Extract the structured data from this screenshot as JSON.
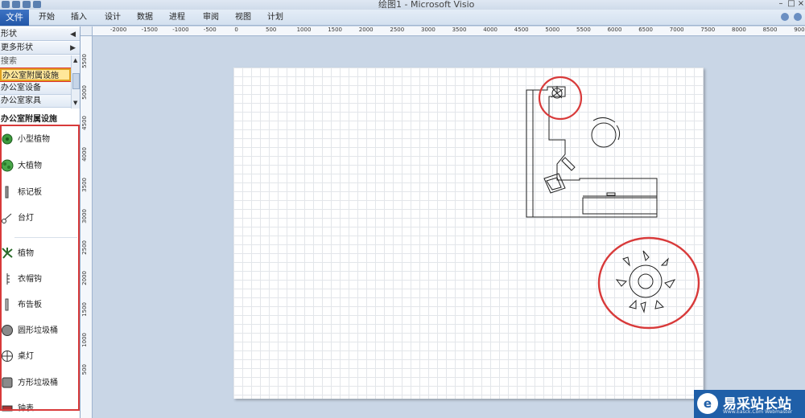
{
  "window": {
    "title": "绘图1 - Microsoft Visio"
  },
  "ribbon": {
    "file_label": "文件",
    "tabs": [
      "开始",
      "插入",
      "设计",
      "数据",
      "进程",
      "审阅",
      "视图",
      "计划"
    ]
  },
  "shapes_panel": {
    "header": "形状",
    "more_shapes": "更多形状",
    "search": "搜索",
    "stencils": [
      "办公室附属设施",
      "办公室设备",
      "办公室家具"
    ],
    "section_title": "办公室附属设施",
    "items": [
      {
        "label": "小型植物",
        "icon": "small-plant-icon"
      },
      {
        "label": "大植物",
        "icon": "large-plant-icon"
      },
      {
        "label": "标记板",
        "icon": "marker-board-icon"
      },
      {
        "label": "台灯",
        "icon": "desk-lamp-icon"
      },
      {
        "label": "植物",
        "icon": "plant-icon"
      },
      {
        "label": "衣帽钩",
        "icon": "coat-hook-icon"
      },
      {
        "label": "布告板",
        "icon": "bulletin-board-icon"
      },
      {
        "label": "圆形垃圾桶",
        "icon": "round-wastebasket-icon"
      },
      {
        "label": "桌灯",
        "icon": "table-lamp-icon"
      },
      {
        "label": "方形垃圾桶",
        "icon": "square-wastebasket-icon"
      },
      {
        "label": "钟表",
        "icon": "clock-icon"
      }
    ]
  },
  "ruler": {
    "top_labels": [
      "-2000",
      "-1500",
      "-1000",
      "-500",
      "0",
      "500",
      "1000",
      "1500",
      "2000",
      "2500",
      "3000",
      "3500",
      "4000",
      "4500",
      "5000",
      "5500",
      "6000",
      "6500",
      "7000",
      "7500",
      "8000",
      "8500",
      "9000",
      "9500"
    ],
    "left_labels": [
      "5500",
      "5000",
      "4500",
      "4000",
      "3500",
      "3000",
      "2500",
      "2000",
      "1500",
      "1000",
      "500"
    ]
  },
  "watermark": {
    "brand": "易采站长站",
    "sub": "Www.Easck.Com  Webmaster"
  },
  "colors": {
    "annotation_red": "#d83a3a",
    "file_tab": "#2a5fb0",
    "active_stencil": "#ffe79a"
  }
}
